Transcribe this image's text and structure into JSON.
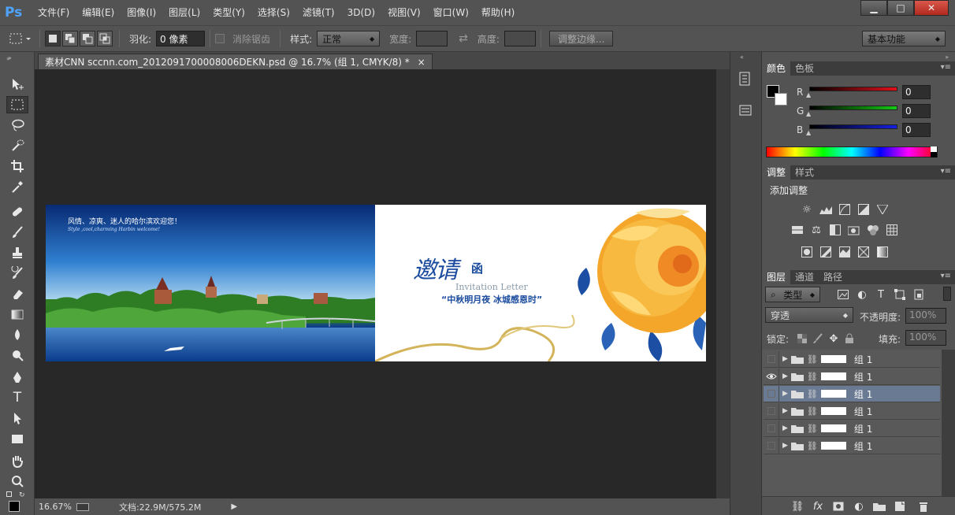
{
  "app": {
    "logo": "Ps"
  },
  "menu": [
    "文件(F)",
    "编辑(E)",
    "图像(I)",
    "图层(L)",
    "类型(Y)",
    "选择(S)",
    "滤镜(T)",
    "3D(D)",
    "视图(V)",
    "窗口(W)",
    "帮助(H)"
  ],
  "window_controls": {
    "minimize": "▁",
    "maximize": "□",
    "close": "✕"
  },
  "options": {
    "feather_label": "羽化:",
    "feather_value": "0 像素",
    "antialias_label": "消除锯齿",
    "style_label": "样式:",
    "style_value": "正常",
    "width_label": "宽度:",
    "height_label": "高度:",
    "refine_edge_button": "调整边缘...",
    "workspace_value": "基本功能"
  },
  "document": {
    "tab_title": "素材CNN sccnn.com_2012091700008006DEKN.psd @ 16.7% (组 1, CMYK/8) *",
    "tab_close": "×",
    "zoom": "16.67%",
    "doc_size": "文档:22.9M/575.2M"
  },
  "image_content": {
    "left_caption": "风情、凉爽、迷人的哈尔滨欢迎您！",
    "left_caption_en": "Style ,cool,charming Harbin welcome!",
    "calligraphy": "邀请",
    "han": "函",
    "invitation_en": "Invitation Letter",
    "subtitle": "“中秋明月夜 冰城感恩时”"
  },
  "color_panel": {
    "tabs": [
      "颜色",
      "色板"
    ],
    "channels": [
      {
        "label": "R",
        "value": "0",
        "color": "#e0101a"
      },
      {
        "label": "G",
        "value": "0",
        "color": "#14c814"
      },
      {
        "label": "B",
        "value": "0",
        "color": "#1420e0"
      }
    ]
  },
  "adjust_panel": {
    "tabs": [
      "调整",
      "样式"
    ],
    "title": "添加调整"
  },
  "layers_panel": {
    "tabs": [
      "图层",
      "通道",
      "路径"
    ],
    "kind_filter": "类型",
    "blend_mode": "穿透",
    "opacity_label": "不透明度:",
    "opacity_value": "100%",
    "lock_label": "锁定:",
    "fill_label": "填充:",
    "fill_value": "100%",
    "layers": [
      {
        "name": "组 1",
        "visible": false,
        "selected": false
      },
      {
        "name": "组 1",
        "visible": true,
        "selected": false
      },
      {
        "name": "组 1",
        "visible": false,
        "selected": true
      },
      {
        "name": "组 1",
        "visible": false,
        "selected": false
      },
      {
        "name": "组 1",
        "visible": false,
        "selected": false
      },
      {
        "name": "组 1",
        "visible": false,
        "selected": false
      }
    ]
  }
}
